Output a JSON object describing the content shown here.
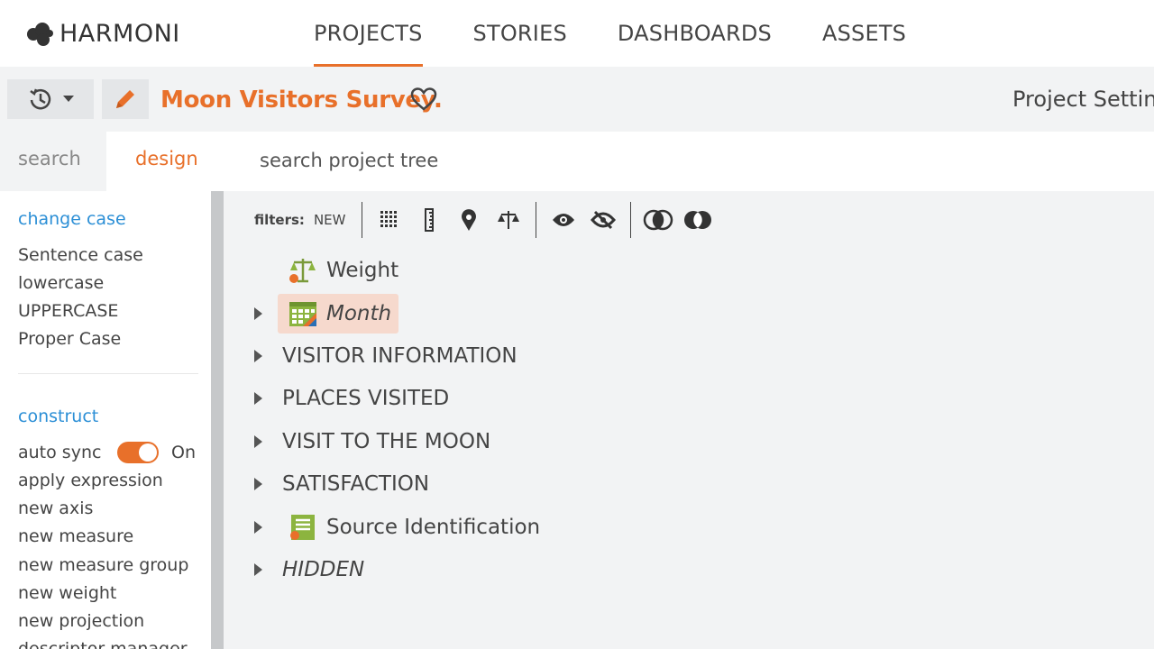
{
  "app": {
    "brand": "HARMONI"
  },
  "nav": {
    "items": [
      "PROJECTS",
      "STORIES",
      "DASHBOARDS",
      "ASSETS"
    ],
    "active": "PROJECTS"
  },
  "project": {
    "title": "Moon Visitors Survey.",
    "settings_label": "Project Settin"
  },
  "left_tabs": {
    "search": "search",
    "design": "design"
  },
  "change_case": {
    "title": "change case",
    "items": [
      "Sentence case",
      "lowercase",
      "UPPERCASE",
      "Proper Case"
    ]
  },
  "construct": {
    "title": "construct",
    "auto_sync_label": "auto sync",
    "auto_sync_state": "On",
    "items": [
      "apply expression",
      "new axis",
      "new measure",
      "new measure group",
      "new weight",
      "new projection",
      "descriptor manager"
    ]
  },
  "tree_search": {
    "placeholder": "search project tree"
  },
  "filters": {
    "label": "filters:",
    "new_label": "NEW"
  },
  "tree": {
    "rows": [
      {
        "label": "Weight",
        "icon": "scale-icon",
        "expandable": false,
        "italic": false
      },
      {
        "label": "Month",
        "icon": "calendar-icon",
        "expandable": true,
        "italic": true,
        "selected": true
      },
      {
        "label": "VISITOR INFORMATION",
        "icon": "",
        "expandable": true,
        "italic": false
      },
      {
        "label": "PLACES VISITED",
        "icon": "",
        "expandable": true,
        "italic": false
      },
      {
        "label": "VISIT TO THE MOON",
        "icon": "",
        "expandable": true,
        "italic": false
      },
      {
        "label": "SATISFACTION",
        "icon": "",
        "expandable": true,
        "italic": false
      },
      {
        "label": "Source Identification",
        "icon": "document-icon",
        "expandable": true,
        "italic": false
      },
      {
        "label": "HIDDEN",
        "icon": "",
        "expandable": true,
        "italic": true
      }
    ]
  },
  "colors": {
    "accent": "#e8702a",
    "link": "#2c8fd6",
    "selected_bg": "#f6d9cd"
  }
}
